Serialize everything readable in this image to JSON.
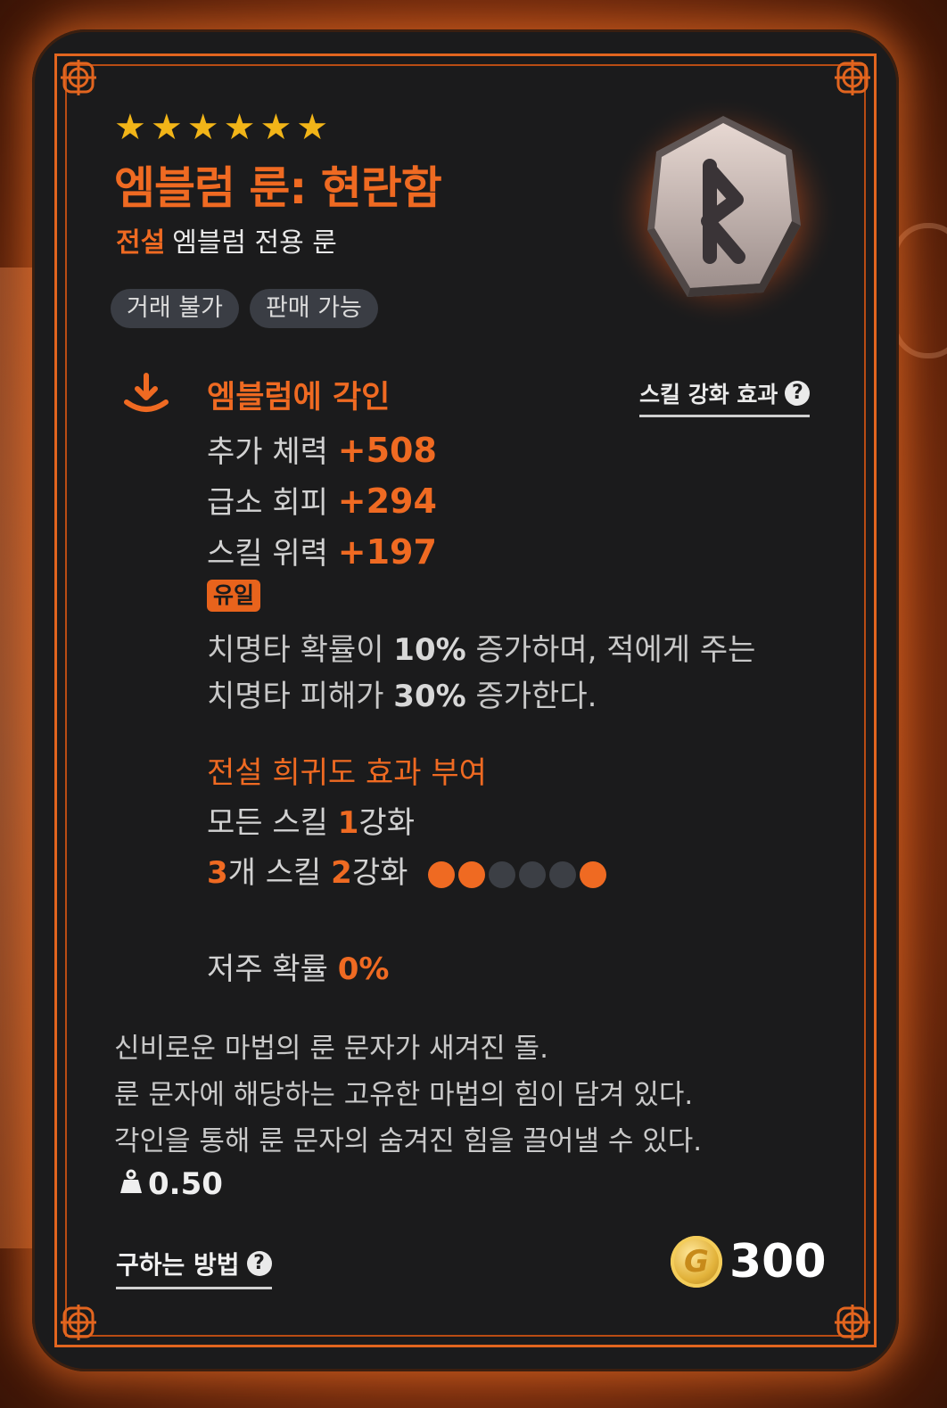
{
  "item": {
    "stars": [
      "★",
      "★",
      "★",
      "★",
      "★",
      "★"
    ],
    "name": "엠블럼 룬: 현란함",
    "grade": "전설",
    "category": "엠블럼 전용 룬",
    "tags": [
      "거래 불가",
      "판매 가능"
    ]
  },
  "engrave": {
    "title": "엠블럼에 각인",
    "skill_link": "스킬 강화 효과",
    "stats": [
      {
        "label": "추가 체력",
        "value": "+508"
      },
      {
        "label": "급소 회피",
        "value": "+294"
      },
      {
        "label": "스킬 위력",
        "value": "+197"
      }
    ],
    "unique_badge": "유일",
    "unique_desc": {
      "line1_pre": "치명타 확률이 ",
      "line1_val": "10%",
      "line1_post": " 증가하며, 적에게 주는",
      "line2_pre": "치명타 피해가 ",
      "line2_val": "30%",
      "line2_post": " 증가한다."
    }
  },
  "legend_effect": {
    "title": "전설 희귀도 효과 부여",
    "all_skills_pre": "모든 스킬 ",
    "all_skills_n": "1",
    "all_skills_post": "강화",
    "three_n": "3",
    "three_mid": "개 스킬 ",
    "three_lv": "2",
    "three_post": "강화",
    "dots": [
      {
        "color": "#ef6a22"
      },
      {
        "color": "#ef6a22"
      },
      {
        "color": "#3c3f45"
      },
      {
        "color": "#3c3f45"
      },
      {
        "color": "#3c3f45"
      },
      {
        "color": "#ef6a22"
      }
    ]
  },
  "curse": {
    "label": "저주 확률",
    "value": "0%"
  },
  "lore": [
    "신비로운 마법의 룬 문자가 새겨진 돌.",
    "룬 문자에 해당하는 고유한 마법의 힘이 담겨 있다.",
    "각인을 통해 룬 문자의 숨겨진 힘을 끌어낼 수 있다."
  ],
  "weight": "0.50",
  "footer": {
    "how_to_get": "구하는 방법",
    "price": "300",
    "coin_letter": "G"
  },
  "colors": {
    "accent": "#ef6a22",
    "star": "#f2b518",
    "card_bg": "#1b1b1c"
  }
}
